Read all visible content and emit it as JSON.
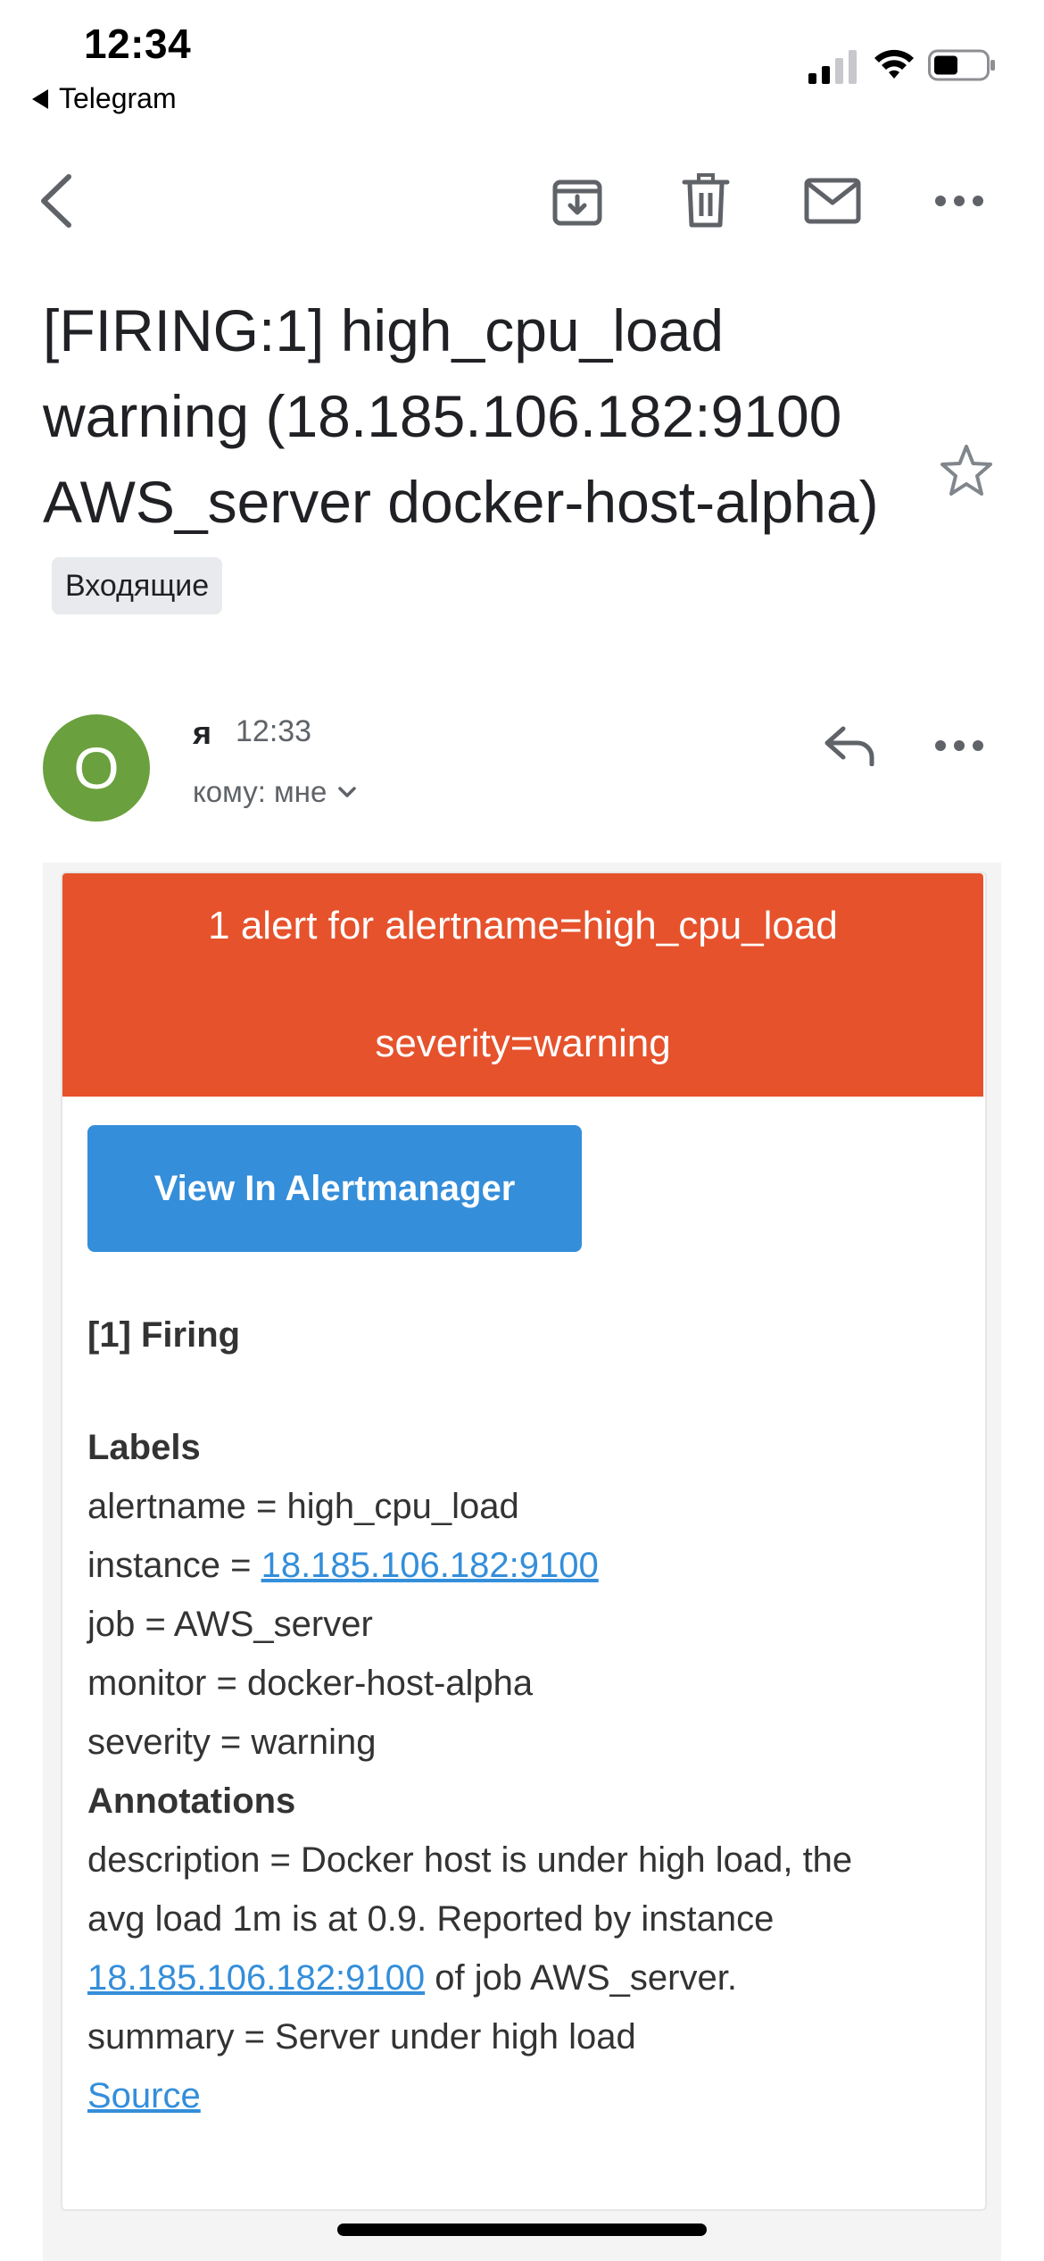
{
  "status_bar": {
    "time": "12:34",
    "back_app": "Telegram"
  },
  "toolbar": {
    "icons": [
      "back-arrow-icon",
      "archive-icon",
      "trash-icon",
      "mail-icon",
      "more-icon"
    ]
  },
  "email": {
    "subject": "[FIRING:1] high_cpu_load warning (18.185.106.182:9100 AWS_server docker-host-alpha)",
    "label": "Входящие",
    "sender": {
      "avatar_letter": "O",
      "avatar_color": "#6aa03d",
      "name": "я",
      "time": "12:33",
      "recipients": "кому: мне"
    }
  },
  "message": {
    "header_color": "#e6522c",
    "header_line1": "1 alert for alertname=high_cpu_load",
    "header_line2": "severity=warning",
    "button_color": "#348eda",
    "button_label": "View In Alertmanager",
    "firing_title": "[1] Firing",
    "labels_title": "Labels",
    "labels": {
      "alertname": "alertname = high_cpu_load",
      "instance_prefix": "instance = ",
      "instance_link": "18.185.106.182:9100",
      "job": "job = AWS_server",
      "monitor": "monitor = docker-host-alpha",
      "severity": "severity = warning"
    },
    "annotations_title": "Annotations",
    "annotations": {
      "description_line1": "description = Docker host is under high load, the",
      "description_line2": "avg load 1m is at 0.9. Reported by instance",
      "description_link": "18.185.106.182:9100",
      "description_suffix": " of job AWS_server.",
      "summary": "summary = Server under high load"
    },
    "source_link": "Source"
  }
}
